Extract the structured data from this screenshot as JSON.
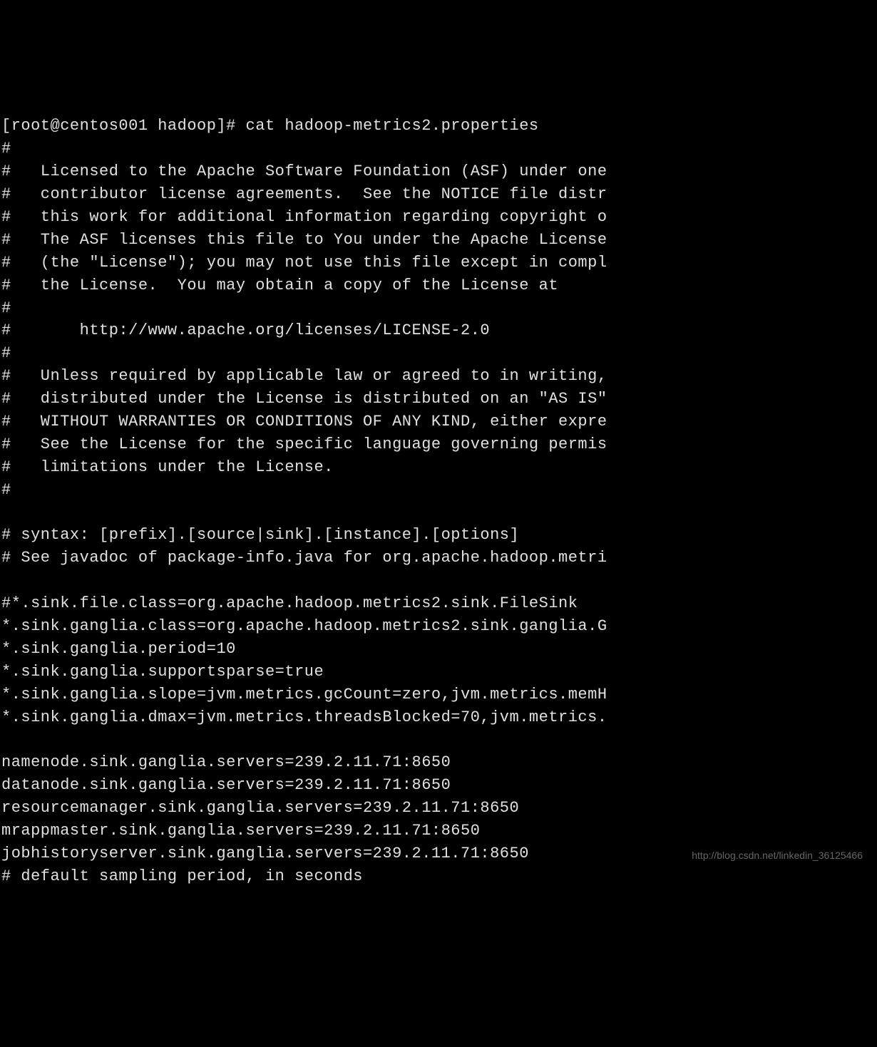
{
  "terminal": {
    "lines": [
      "[root@centos001 hadoop]# cat hadoop-metrics2.properties",
      "#",
      "#   Licensed to the Apache Software Foundation (ASF) under one",
      "#   contributor license agreements.  See the NOTICE file distr",
      "#   this work for additional information regarding copyright o",
      "#   The ASF licenses this file to You under the Apache License",
      "#   (the \"License\"); you may not use this file except in compl",
      "#   the License.  You may obtain a copy of the License at",
      "#",
      "#       http://www.apache.org/licenses/LICENSE-2.0",
      "#",
      "#   Unless required by applicable law or agreed to in writing,",
      "#   distributed under the License is distributed on an \"AS IS\"",
      "#   WITHOUT WARRANTIES OR CONDITIONS OF ANY KIND, either expre",
      "#   See the License for the specific language governing permis",
      "#   limitations under the License.",
      "#",
      "",
      "# syntax: [prefix].[source|sink].[instance].[options]",
      "# See javadoc of package-info.java for org.apache.hadoop.metri",
      "",
      "#*.sink.file.class=org.apache.hadoop.metrics2.sink.FileSink",
      "*.sink.ganglia.class=org.apache.hadoop.metrics2.sink.ganglia.G",
      "*.sink.ganglia.period=10",
      "*.sink.ganglia.supportsparse=true",
      "*.sink.ganglia.slope=jvm.metrics.gcCount=zero,jvm.metrics.memH",
      "*.sink.ganglia.dmax=jvm.metrics.threadsBlocked=70,jvm.metrics.",
      "",
      "namenode.sink.ganglia.servers=239.2.11.71:8650",
      "datanode.sink.ganglia.servers=239.2.11.71:8650",
      "resourcemanager.sink.ganglia.servers=239.2.11.71:8650",
      "mrappmaster.sink.ganglia.servers=239.2.11.71:8650",
      "jobhistoryserver.sink.ganglia.servers=239.2.11.71:8650",
      "# default sampling period, in seconds"
    ]
  },
  "watermark": {
    "text": "http://blog.csdn.net/linkedin_36125466"
  }
}
